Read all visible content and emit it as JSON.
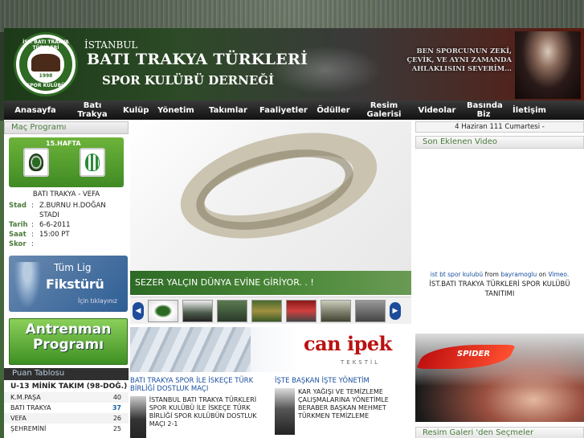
{
  "header": {
    "top": "İSTANBUL",
    "title": "BATI TRAKYA TÜRKLERİ",
    "subtitle": "SPOR KULÜBÜ DERNEĞİ",
    "crest_top": "İST. BATI TRAKYA TÜRKLERİ",
    "crest_bottom": "SPOR KULÜBÜ",
    "crest_year": "1998",
    "quote": "BEN SPORCUNUN ZEKİ, ÇEVİK, VE AYNI ZAMANDA AHLAKLISINI SEVERİM..."
  },
  "nav": [
    "Anasayfa",
    "Batı Trakya",
    "Kulüp",
    "Yönetim",
    "Takımlar",
    "Faaliyetler",
    "Ödüller",
    "Resim Galerisi",
    "Videolar",
    "Basında Biz",
    "İletişim"
  ],
  "left": {
    "mac_head": "Maç Programı",
    "week": "15.HAFTA",
    "match_name": "BATI TRAKYA - VEFA",
    "details": [
      {
        "k": "Stad",
        "v": "Z.BURNU H.DOĞAN STADI"
      },
      {
        "k": "Tarih",
        "v": "6-6-2011"
      },
      {
        "k": "Saat",
        "v": "15:00 PT"
      },
      {
        "k": "Skor",
        "v": ""
      }
    ],
    "fikstur": {
      "l1": "Tüm Lig",
      "l2": "Fikstürü",
      "l3": "İçin tıklayınız"
    },
    "antren": {
      "l1": "Antrenman",
      "l2": "Programı"
    },
    "puan_head": "Puan Tablosu",
    "league": "U-13 MİNİK TAKIM (98-DOĞ.)",
    "standings": [
      {
        "team": "K.M.PAŞA",
        "pts": "40"
      },
      {
        "team": "BATI TRAKYA",
        "pts": "37"
      },
      {
        "team": "VEFA",
        "pts": "26"
      },
      {
        "team": "ŞEHREMİNİ",
        "pts": "25"
      }
    ]
  },
  "center": {
    "caption": "SEZER YALÇIN DÜNYA EVİNE GİRİYOR. . !",
    "prev": "◀",
    "next": "▶",
    "banner_brand": "can ipek",
    "banner_sub": "TEKSTİL",
    "news1_title": "BATI TRAKYA SPOR İLE İSKEÇE TÜRK BİRLİĞİ DOSTLUK MAÇI",
    "news1_text": "İSTANBUL BATI TRAKYA TÜRKLERİ SPOR KULÜBÜ İLE İSKEÇE TÜRK BİRLİĞİ SPOR KULÜBÜN DOSTLUK MAÇI 2-1",
    "news2_title": "İŞTE BAŞKAN İŞTE YÖNETİM",
    "news2_text": "KAR YAĞIŞI VE TEMİZLEME ÇALIŞMALARINA YÖNETİMLE BERABER BAŞKAN MEHMET TÜRKMEN TEMİZLEME"
  },
  "right": {
    "date": "4 Haziran 111 Cumartesi -",
    "video_head": "Son Eklenen Video",
    "vimeo_title": "ist bt spor kulubü",
    "vimeo_from": "from",
    "vimeo_user": "bayramoglu",
    "vimeo_on": "on",
    "vimeo_site": "Vimeo.",
    "video_title": "İST.BATI TRAKYA TÜRKLERİ SPOR KULÜBÜ TANITIMI",
    "spider": "SPIDER",
    "gallery_head": "Resim Galeri 'den Seçmeler"
  }
}
